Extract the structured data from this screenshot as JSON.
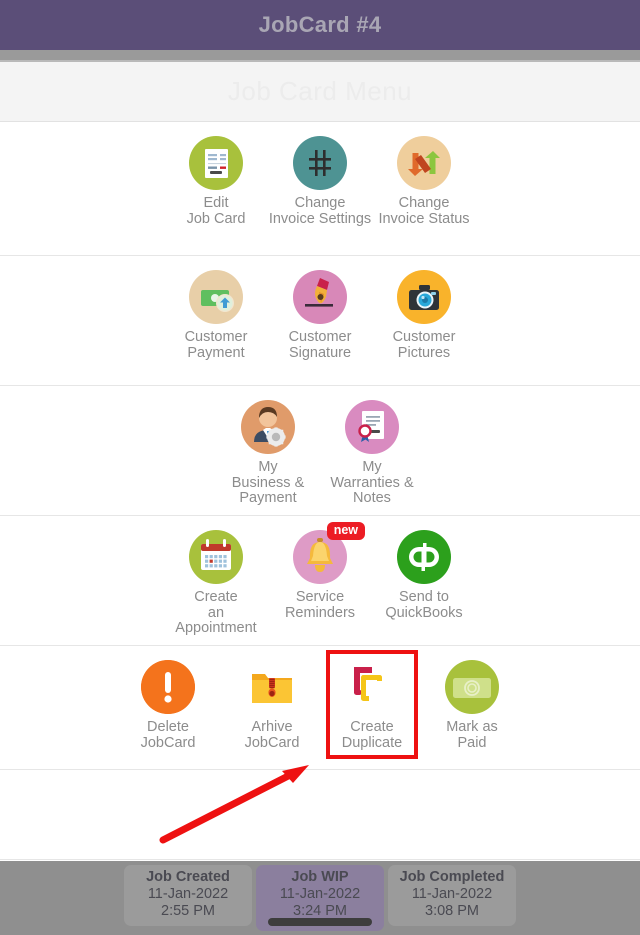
{
  "titlebar": {
    "title": "JobCard #4"
  },
  "menu_header": {
    "title": "Job Card Menu"
  },
  "rows": [
    {
      "name": "row-invoice",
      "tiles": [
        {
          "name": "edit-job-card",
          "label": "Edit\nJob Card",
          "icon": "document-edit-icon",
          "circle_color": "#A8C13C"
        },
        {
          "name": "change-invoice-settings",
          "label": "Change\nInvoice Settings",
          "icon": "hash-grid-icon",
          "circle_color": "#4E9393"
        },
        {
          "name": "change-invoice-status",
          "label": "Change\nInvoice Status",
          "icon": "two-arrows-icon",
          "circle_color": "#EFCE9C"
        }
      ]
    },
    {
      "name": "row-customer",
      "tiles": [
        {
          "name": "customer-payment",
          "label": "Customer\nPayment",
          "icon": "money-arrow-icon",
          "circle_color": "#E8CFA8"
        },
        {
          "name": "customer-signature",
          "label": "Customer\nSignature",
          "icon": "fountain-pen-icon",
          "circle_color": "#D888B8"
        },
        {
          "name": "customer-pictures",
          "label": "Customer\nPictures",
          "icon": "camera-icon",
          "circle_color": "#F9B32B"
        }
      ]
    },
    {
      "name": "row-my",
      "tiles": [
        {
          "name": "my-business-payment",
          "label": "My\nBusiness &\nPayment",
          "icon": "businessman-gear-icon",
          "circle_color": "#E09B6A"
        },
        {
          "name": "my-warranties-notes",
          "label": "My\nWarranties &\nNotes",
          "icon": "certificate-icon",
          "circle_color": "#D98BC0"
        }
      ]
    },
    {
      "name": "row-actions",
      "tiles": [
        {
          "name": "create-an-appointment",
          "label": "Create\nan\nAppointment",
          "icon": "calendar-icon",
          "circle_color": "#A8C13C"
        },
        {
          "name": "service-reminders",
          "label": "Service\nReminders",
          "icon": "bell-icon",
          "circle_color": "#DE9BC6",
          "badge": "new",
          "badge_color": "#EC1C24"
        },
        {
          "name": "send-to-quickbooks",
          "label": "Send to\nQuickBooks",
          "icon": "quickbooks-icon",
          "circle_color": "#2CA01C"
        }
      ]
    },
    {
      "name": "row-jobcard-ops",
      "tiles": [
        {
          "name": "delete-jobcard",
          "label": "Delete\nJobCard",
          "icon": "exclamation-circle-icon",
          "circle_color": "#F4731C"
        },
        {
          "name": "arhive-jobcard",
          "label": "Arhive\nJobCard",
          "icon": "zip-folder-icon",
          "circle_color": "#FFFFFF"
        },
        {
          "name": "create-duplicate",
          "label": "Create\nDuplicate",
          "icon": "copy-stack-icon",
          "circle_color": "#FFFFFF",
          "highlighted": true
        },
        {
          "name": "mark-as-paid",
          "label": "Mark as\nPaid",
          "icon": "banknote-icon",
          "circle_color": "#A8C13C"
        }
      ]
    }
  ],
  "annotation": {
    "arrow_color": "#EE1111",
    "highlight_color": "#EE1111"
  },
  "footer": {
    "cards": [
      {
        "name": "job-created",
        "title": "Job Created",
        "date": "11-Jan-2022",
        "time": "2:55 PM",
        "active": false
      },
      {
        "name": "job-wip",
        "title": "Job WIP",
        "date": "11-Jan-2022",
        "time": "3:24 PM",
        "active": true
      },
      {
        "name": "job-completed",
        "title": "Job Completed",
        "date": "11-Jan-2022",
        "time": "3:08 PM",
        "active": false
      }
    ]
  }
}
